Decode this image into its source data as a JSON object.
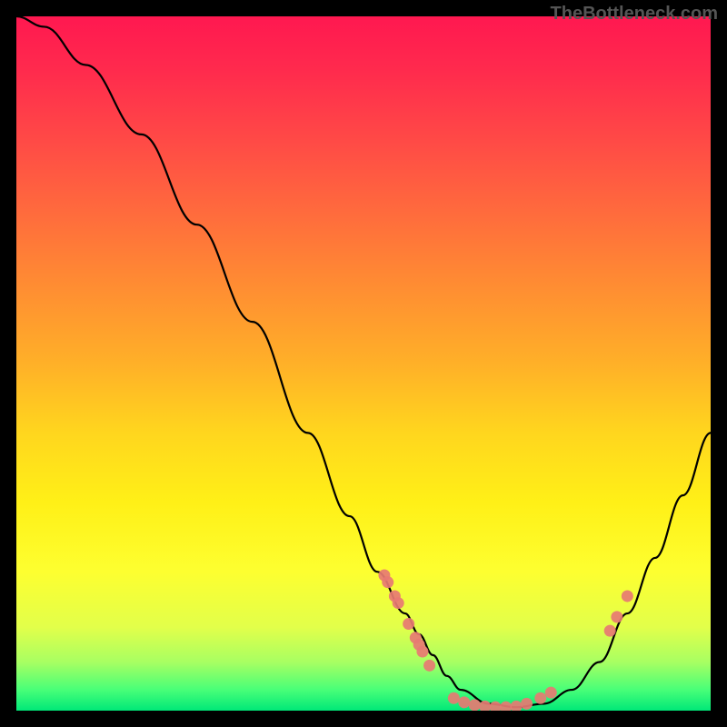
{
  "watermark": "TheBottleneck.com",
  "chart_data": {
    "type": "line",
    "title": "",
    "xlabel": "",
    "ylabel": "",
    "xlim": [
      0,
      1
    ],
    "ylim": [
      0,
      1
    ],
    "series": [
      {
        "name": "curve",
        "x": [
          0.0,
          0.04,
          0.1,
          0.18,
          0.26,
          0.34,
          0.42,
          0.48,
          0.52,
          0.56,
          0.58,
          0.6,
          0.62,
          0.64,
          0.68,
          0.72,
          0.76,
          0.8,
          0.84,
          0.88,
          0.92,
          0.96,
          1.0
        ],
        "y": [
          1.0,
          0.985,
          0.93,
          0.83,
          0.7,
          0.56,
          0.4,
          0.28,
          0.2,
          0.14,
          0.11,
          0.08,
          0.05,
          0.03,
          0.01,
          0.005,
          0.01,
          0.03,
          0.07,
          0.14,
          0.22,
          0.31,
          0.4
        ]
      }
    ],
    "markers": [
      {
        "name": "cluster-left-upper",
        "points": [
          {
            "x": 0.53,
            "y": 0.195
          },
          {
            "x": 0.535,
            "y": 0.185
          },
          {
            "x": 0.545,
            "y": 0.165
          },
          {
            "x": 0.55,
            "y": 0.155
          }
        ]
      },
      {
        "name": "cluster-left-lower",
        "points": [
          {
            "x": 0.565,
            "y": 0.125
          },
          {
            "x": 0.575,
            "y": 0.105
          },
          {
            "x": 0.58,
            "y": 0.095
          },
          {
            "x": 0.585,
            "y": 0.085
          },
          {
            "x": 0.595,
            "y": 0.065
          }
        ]
      },
      {
        "name": "cluster-bottom",
        "points": [
          {
            "x": 0.63,
            "y": 0.018
          },
          {
            "x": 0.645,
            "y": 0.012
          },
          {
            "x": 0.66,
            "y": 0.008
          },
          {
            "x": 0.675,
            "y": 0.006
          },
          {
            "x": 0.69,
            "y": 0.005
          },
          {
            "x": 0.705,
            "y": 0.005
          },
          {
            "x": 0.72,
            "y": 0.006
          },
          {
            "x": 0.735,
            "y": 0.01
          },
          {
            "x": 0.755,
            "y": 0.018
          },
          {
            "x": 0.77,
            "y": 0.026
          }
        ]
      },
      {
        "name": "cluster-right",
        "points": [
          {
            "x": 0.855,
            "y": 0.115
          },
          {
            "x": 0.865,
            "y": 0.135
          },
          {
            "x": 0.88,
            "y": 0.165
          }
        ]
      }
    ],
    "colors": {
      "curve": "#000000",
      "marker_fill": "#e77a73",
      "marker_stroke": "#e77a73"
    }
  }
}
